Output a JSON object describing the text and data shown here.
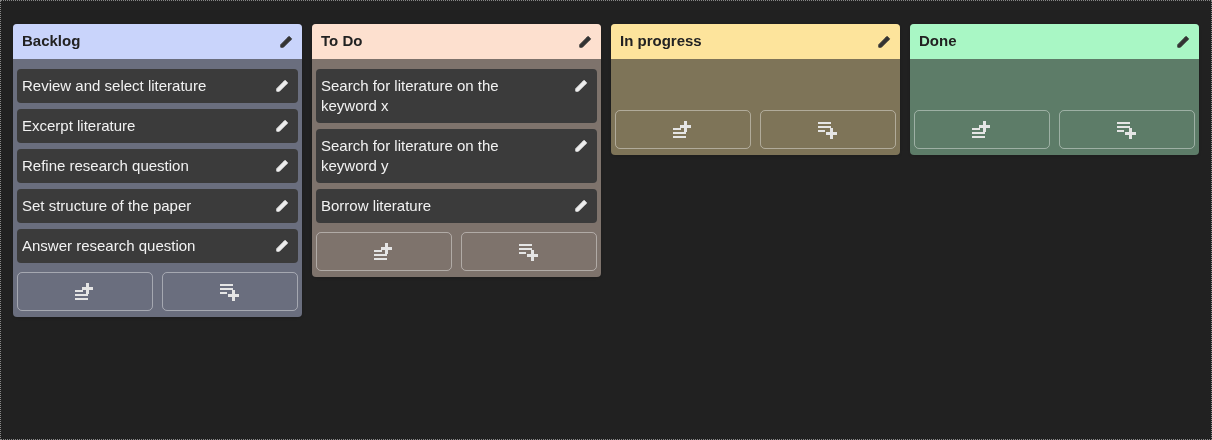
{
  "columns": [
    {
      "title": "Backlog",
      "color": "#c9d4fb",
      "cards": [
        "Review and select literature",
        "Excerpt literature",
        "Refine research question",
        "Set structure of the paper",
        "Answer research question"
      ]
    },
    {
      "title": "To Do",
      "color": "#fde0cf",
      "cards": [
        "Search for literature on the keyword x",
        "Search for literature on the keyword y",
        "Borrow literature"
      ]
    },
    {
      "title": "In progress",
      "color": "#fde49c"
    },
    {
      "title": "Done",
      "color": "#a9f7c5"
    }
  ]
}
